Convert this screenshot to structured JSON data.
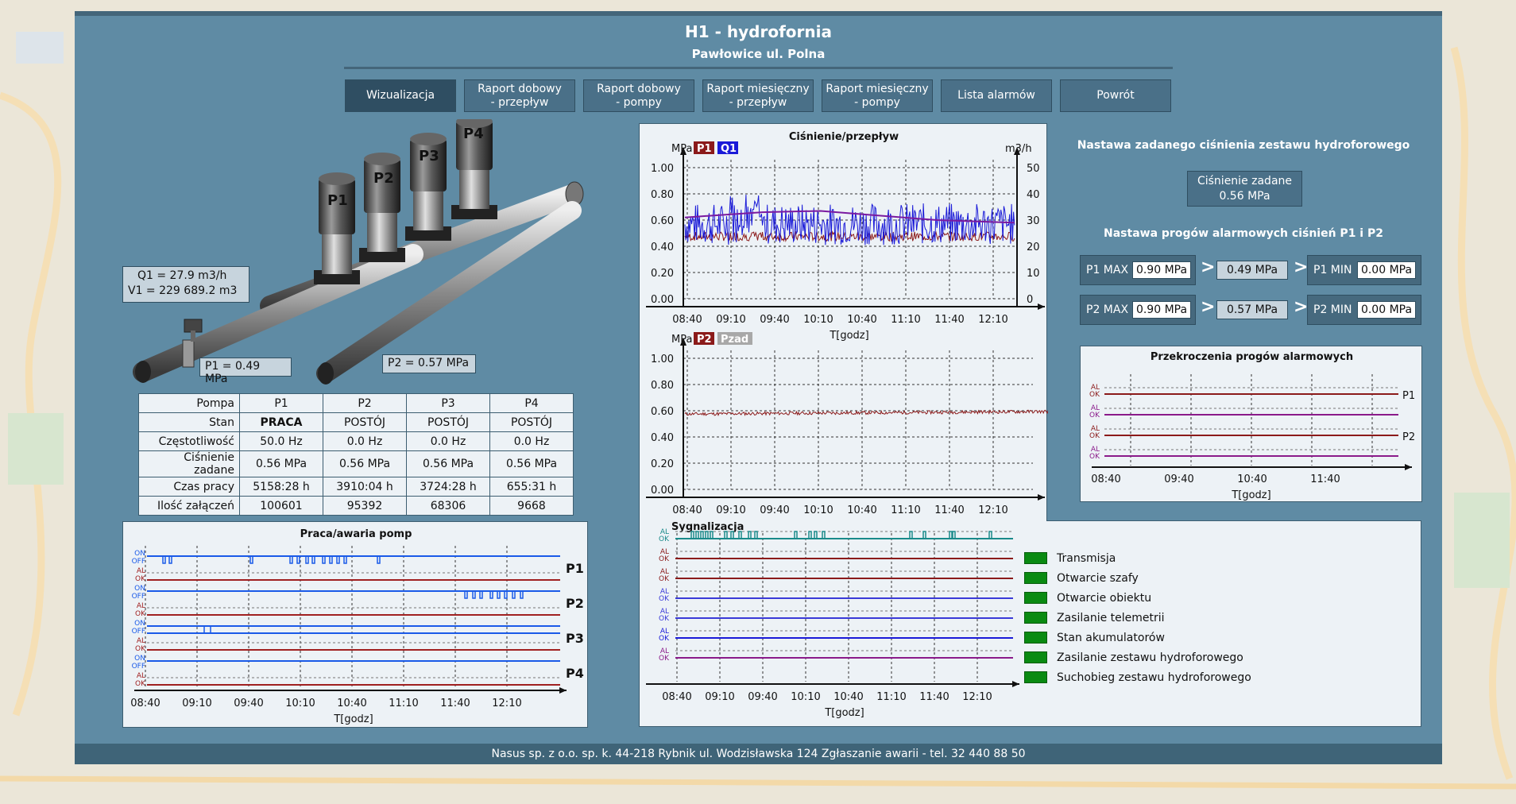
{
  "header": {
    "title": "H1 - hydrofornia",
    "subtitle": "Pawłowice ul. Polna"
  },
  "nav": [
    {
      "label1": "Wizualizacja",
      "label2": "",
      "active": true
    },
    {
      "label1": "Raport dobowy",
      "label2": "- przepływ"
    },
    {
      "label1": "Raport dobowy",
      "label2": "- pompy"
    },
    {
      "label1": "Raport miesięczny",
      "label2": "- przepływ"
    },
    {
      "label1": "Raport miesięczny",
      "label2": "- pompy"
    },
    {
      "label1": "Lista alarmów",
      "label2": ""
    },
    {
      "label1": "Powrót",
      "label2": ""
    }
  ],
  "diagram": {
    "pump_labels": [
      "P1",
      "P2",
      "P3",
      "P4"
    ],
    "flow": {
      "q_line": "Q1 =   27.9 m3/h",
      "v_line": "V1 =   229 689.2 m3"
    },
    "p1": "P1 =  0.49 MPa",
    "p2": "P2 =  0.57 MPa"
  },
  "pump_table": {
    "header": [
      "Pompa",
      "P1",
      "P2",
      "P3",
      "P4"
    ],
    "rows": [
      [
        "Stan",
        "PRACA",
        "POSTÓJ",
        "POSTÓJ",
        "POSTÓJ"
      ],
      [
        "Częstotliwość",
        "50.0 Hz",
        "0.0 Hz",
        "0.0 Hz",
        "0.0 Hz"
      ],
      [
        "Ciśnienie zadane",
        "0.56 MPa",
        "0.56 MPa",
        "0.56 MPa",
        "0.56 MPa"
      ],
      [
        "Czas pracy",
        "5158:28 h",
        "3910:04 h",
        "3724:28 h",
        "655:31 h"
      ],
      [
        "Ilość załączeń",
        "100601",
        "95392",
        "68306",
        "9668"
      ]
    ]
  },
  "work_chart": {
    "title": "Praca/awaria pomp",
    "pumps": [
      "P1",
      "P2",
      "P3",
      "P4"
    ],
    "on": "ON",
    "off": "OFF",
    "al": "AL",
    "ok": "OK",
    "xticks": [
      "08:40",
      "09:10",
      "09:40",
      "10:10",
      "10:40",
      "11:10",
      "11:40",
      "12:10"
    ],
    "xlabel": "T[godz]"
  },
  "pressure_chart": {
    "title": "Ciśnienie/przepływ",
    "unit_left": "MPa",
    "unit_right": "m3/h",
    "legend_top": [
      {
        "label": "P1",
        "color": "#8b1a1a"
      },
      {
        "label": "Q1",
        "color": "#1a1ad8"
      }
    ],
    "legend_bottom": [
      {
        "label": "P2",
        "color": "#8b1a1a"
      },
      {
        "label": "Pzad",
        "color": "#a8a8a8"
      }
    ],
    "yticks_left": [
      "1.00",
      "0.80",
      "0.60",
      "0.40",
      "0.20",
      "0.00"
    ],
    "yticks_right": [
      "50",
      "40",
      "30",
      "20",
      "10",
      "0"
    ],
    "xticks": [
      "08:40",
      "09:10",
      "09:40",
      "10:10",
      "10:40",
      "11:10",
      "11:40",
      "12:10"
    ],
    "xlabel": "T[godz]"
  },
  "settings": {
    "pressure_title": "Nastawa zadanego ciśnienia zestawu hydroforowego",
    "pressure_btn1": "Ciśnienie zadane",
    "pressure_btn2": "0.56 MPa",
    "alarm_title": "Nastawa progów alarmowych ciśnień P1 i P2",
    "p1max_label": "P1 MAX",
    "p1max": "0.90 MPa",
    "p1cur": "0.49 MPa",
    "p1min_label": "P1 MIN",
    "p1min": "0.00 MPa",
    "p2max_label": "P2 MAX",
    "p2max": "0.90 MPa",
    "p2cur": "0.57 MPa",
    "p2min_label": "P2 MIN",
    "p2min": "0.00 MPa"
  },
  "threshold_chart": {
    "title": "Przekroczenia progów alarmowych",
    "xticks": [
      "08:40",
      "09:40",
      "10:40",
      "11:40"
    ],
    "xlabel": "T[godz]",
    "labels": [
      "P1",
      "P2"
    ]
  },
  "signals": {
    "title": "Sygnalizacja",
    "items": [
      "Transmisja",
      "Otwarcie szafy",
      "Otwarcie obiektu",
      "Zasilanie telemetrii",
      "Stan akumulatorów",
      "Zasilanie zestawu hydroforowego",
      "Suchobieg zestawu hydroforowego"
    ],
    "xticks": [
      "08:40",
      "09:10",
      "09:40",
      "10:10",
      "10:40",
      "11:10",
      "11:40",
      "12:10"
    ],
    "xlabel": "T[godz]"
  },
  "footer": {
    "text": "Nasus sp. z o.o. sp. k.   44-218 Rybnik ul. Wodzisławska 124   Zgłaszanie awarii - tel. 32 440 88 50"
  }
}
